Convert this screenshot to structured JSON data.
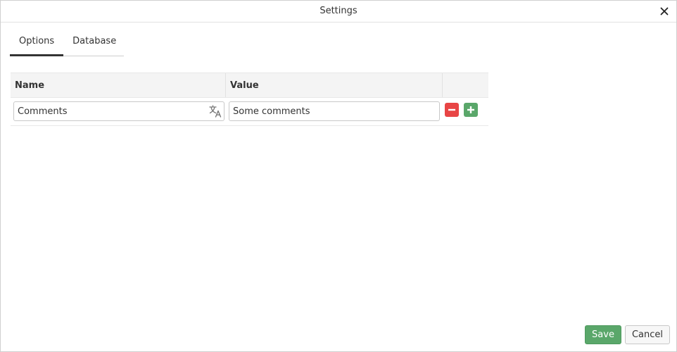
{
  "dialog": {
    "title": "Settings",
    "close_icon": "close-icon"
  },
  "tabs": [
    {
      "label": "Options",
      "active": true
    },
    {
      "label": "Database",
      "active": false
    }
  ],
  "grid": {
    "columns": [
      "Name",
      "Value",
      ""
    ],
    "rows": [
      {
        "name": "Comments",
        "value": "Some comments"
      }
    ]
  },
  "icons": {
    "translate": "translate-icon",
    "remove": "minus-icon",
    "add": "plus-icon"
  },
  "colors": {
    "save": "#5aa76a",
    "remove": "#e84545",
    "add": "#5aa76a"
  },
  "footer": {
    "save_label": "Save",
    "cancel_label": "Cancel"
  }
}
